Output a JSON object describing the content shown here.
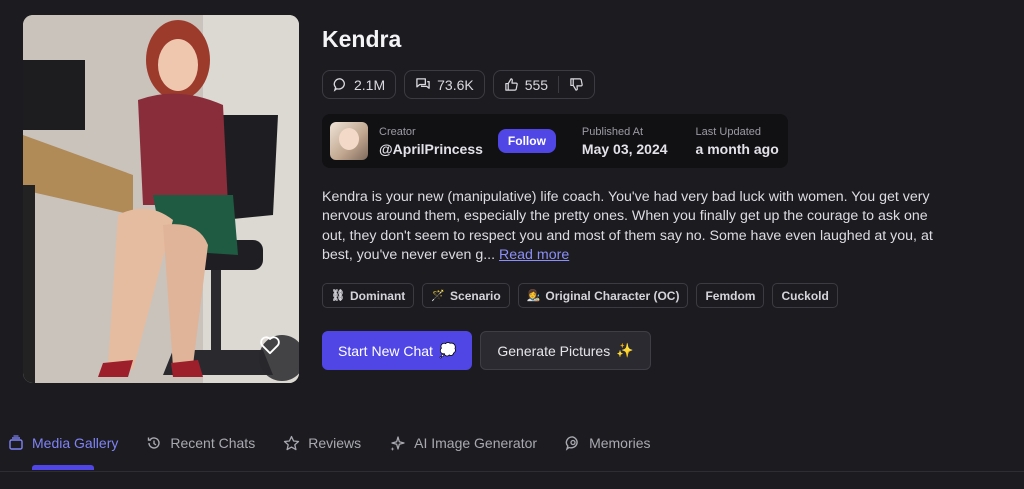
{
  "profile": {
    "name": "Kendra",
    "stats": {
      "chats": "2.1M",
      "messages": "73.6K",
      "likes": "555"
    }
  },
  "creator": {
    "label": "Creator",
    "handle": "@AprilPrincess",
    "follow_label": "Follow",
    "published_label": "Published At",
    "published_value": "May 03, 2024",
    "updated_label": "Last Updated",
    "updated_value": "a month ago"
  },
  "description": {
    "text": "Kendra is your new (manipulative) life coach. You've had very bad luck with women. You get very nervous around them, especially the pretty ones. When you finally get up the courage to ask one out, they don't seem to respect you and most of them say no. Some have even laughed at you, at best, you've never even g...",
    "read_more": "Read more"
  },
  "tags": [
    {
      "emoji": "⛓",
      "label": "Dominant"
    },
    {
      "emoji": "🪄",
      "label": "Scenario"
    },
    {
      "emoji": "👩‍🎨",
      "label": "Original Character (OC)"
    },
    {
      "emoji": "",
      "label": "Femdom"
    },
    {
      "emoji": "",
      "label": "Cuckold"
    }
  ],
  "actions": {
    "start_chat": "Start New Chat",
    "start_chat_emoji": "💭",
    "generate": "Generate Pictures",
    "generate_emoji": "✨"
  },
  "tabs": [
    {
      "label": "Media Gallery",
      "icon": "gallery-icon",
      "active": true
    },
    {
      "label": "Recent Chats",
      "icon": "history-icon",
      "active": false
    },
    {
      "label": "Reviews",
      "icon": "star-icon",
      "active": false
    },
    {
      "label": "AI Image Generator",
      "icon": "sparkle-icon",
      "active": false
    },
    {
      "label": "Memories",
      "icon": "memory-icon",
      "active": false
    }
  ],
  "colors": {
    "background": "#1c1b20",
    "accent": "#5046e5",
    "active_tab": "#7f83f5"
  }
}
